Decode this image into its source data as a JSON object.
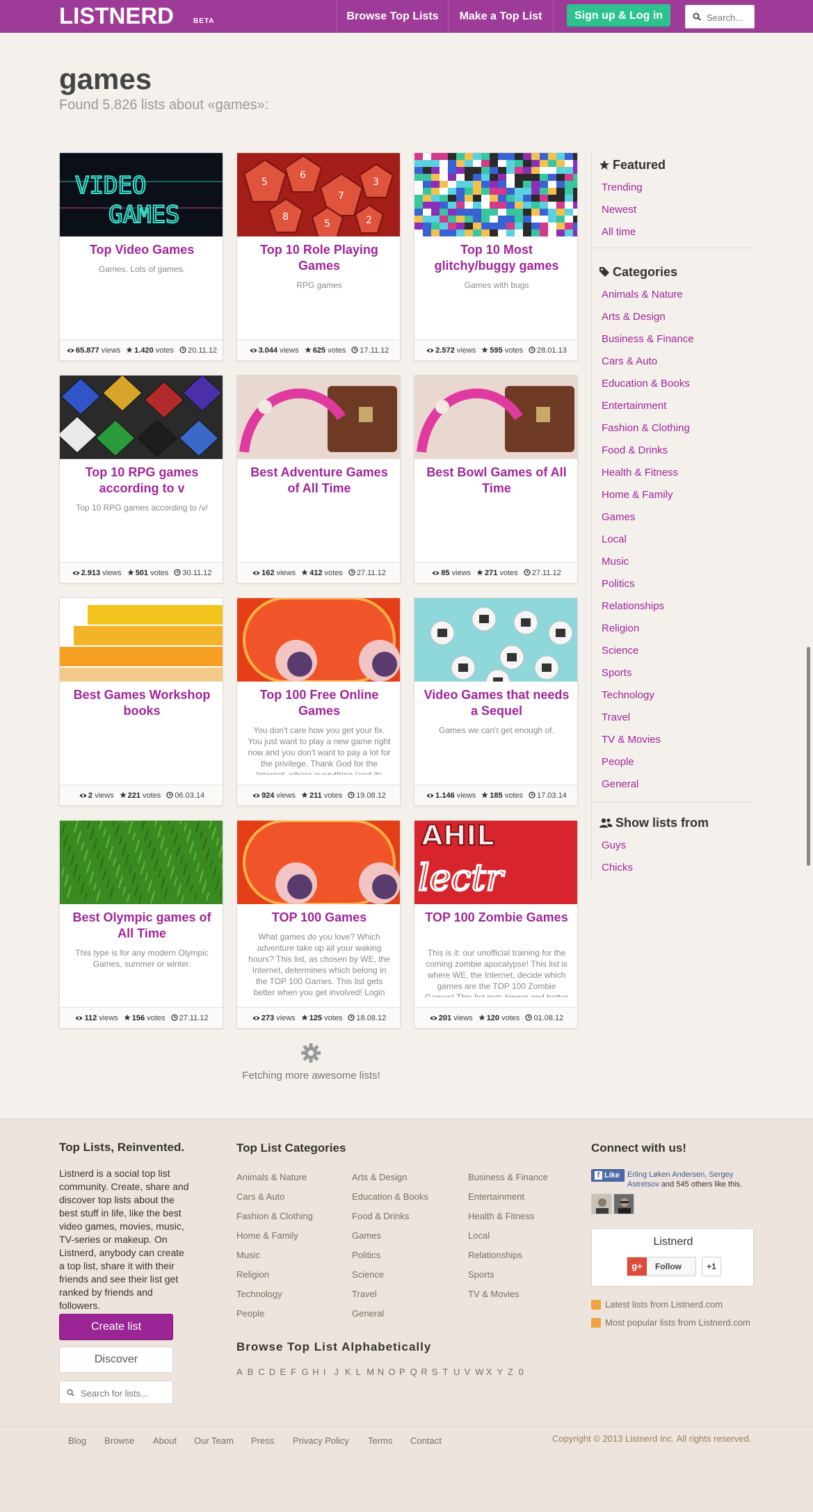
{
  "header": {
    "logo": "LISTNERD",
    "logo_badge": "BETA",
    "nav_browse": "Browse Top Lists",
    "nav_make": "Make a Top List",
    "signup": "Sign up & Log in",
    "search_placeholder": "Search..."
  },
  "page": {
    "title": "games",
    "subtitle": "Found 5.826 lists about «games»:"
  },
  "cards": [
    {
      "title": "Top Video Games",
      "desc": "Games. Lots of games.",
      "views": "65.877",
      "votes": "1.420",
      "date": "20.11.12",
      "image": "video-games"
    },
    {
      "title": "Top 10 Role Playing Games",
      "desc": "RPG games",
      "views": "3.044",
      "votes": "625",
      "date": "17.11.12",
      "image": "red-dice"
    },
    {
      "title": "Top 10 Most glitchy/buggy games",
      "desc": "Games with bugs",
      "views": "2.572",
      "votes": "595",
      "date": "28.01.13",
      "image": "glitch"
    },
    {
      "title": "Top 10 RPG games according to v",
      "desc": "Top 10 RPG games according to /v/",
      "views": "2.913",
      "votes": "501",
      "date": "30.11.12",
      "image": "color-dice"
    },
    {
      "title": "Best Adventure Games of All Time",
      "desc": "",
      "views": "162",
      "votes": "412",
      "date": "27.11.12",
      "image": "handbag"
    },
    {
      "title": "Best Bowl Games of All Time",
      "desc": "",
      "views": "85",
      "votes": "271",
      "date": "27.11.12",
      "image": "handbag"
    },
    {
      "title": "Best Games Workshop books",
      "desc": "",
      "views": "2",
      "votes": "221",
      "date": "06.03.14",
      "image": "books"
    },
    {
      "title": "Top 100 Free Online Games",
      "desc": "You don't care how you get your fix. You just want to play a new game right now and you don't want to pay a lot for the privilege. Thank God for the Internet, where everything (and its mom) is",
      "views": "924",
      "votes": "211",
      "date": "19.08.12",
      "image": "ghost"
    },
    {
      "title": "Video Games that needs a Sequel",
      "desc": "Games we can't get enough of.",
      "views": "1.146",
      "votes": "185",
      "date": "17.03.14",
      "image": "buttons"
    },
    {
      "title": "Best Olympic games of All Time",
      "desc": "This type is for any modern Olympic Games, summer or winter.",
      "views": "112",
      "votes": "156",
      "date": "27.11.12",
      "image": "grass"
    },
    {
      "title": "TOP 100 Games",
      "desc": "What games do you love? Which adventure take up all your waking hours? This list, as chosen by WE, the Internet, determines which belong in the TOP 100 Games. This list gets better when you get involved! Login Now to cast your vote or write in your own!",
      "views": "273",
      "votes": "125",
      "date": "18.08.12",
      "image": "ghost"
    },
    {
      "title": "TOP 100 Zombie Games",
      "desc": "This is it: our unofficial training for the coming zombie apocalypse! This list is where WE, the Internet, decide which games are the TOP 100 Zombie Games! This list gets bigger and better when you join in! Login now to cast your vote or write in your own!!",
      "views": "201",
      "votes": "120",
      "date": "01.08.12",
      "image": "neon"
    }
  ],
  "stats_labels": {
    "views": "views",
    "votes": "votes"
  },
  "sidebar": {
    "featured_title": "Featured",
    "featured": [
      "Trending",
      "Newest",
      "All time"
    ],
    "categories_title": "Categories",
    "categories": [
      "Animals & Nature",
      "Arts & Design",
      "Business & Finance",
      "Cars & Auto",
      "Education & Books",
      "Entertainment",
      "Fashion & Clothing",
      "Food & Drinks",
      "Health & Fitness",
      "Home & Family",
      "Games",
      "Local",
      "Music",
      "Politics",
      "Relationships",
      "Religion",
      "Science",
      "Sports",
      "Technology",
      "Travel",
      "TV & Movies",
      "People",
      "General"
    ],
    "show_title": "Show lists from",
    "show": [
      "Guys",
      "Chicks"
    ]
  },
  "loader": {
    "text": "Fetching more awesome lists!"
  },
  "footer": {
    "about_title": "Top Lists, Reinvented.",
    "about_text": "Listnerd is a social top list community. Create, share and discover top lists about the best stuff in life, like the best video games, movies, music, TV-series or makeup. On Listnerd, anybody can create a top list, share it with their friends and see their list get ranked by friends and followers.",
    "create_btn": "Create list",
    "discover_btn": "Discover",
    "search_placeholder": "Search for lists...",
    "categories_title": "Top List Categories",
    "categories": [
      "Animals & Nature",
      "Arts & Design",
      "Business & Finance",
      "Cars & Auto",
      "Education & Books",
      "Entertainment",
      "Fashion & Clothing",
      "Food & Drinks",
      "Health & Fitness",
      "Home & Family",
      "Games",
      "Local",
      "Music",
      "Politics",
      "Relationships",
      "Religion",
      "Science",
      "Sports",
      "Technology",
      "Travel",
      "TV & Movies",
      "People",
      "General"
    ],
    "alpha_title": "Browse Top List Alphabetically",
    "alphabet": [
      "A",
      "B",
      "C",
      "D",
      "E",
      "F",
      "G",
      "H",
      "I",
      "J",
      "K",
      "L",
      "M",
      "N",
      "O",
      "P",
      "Q",
      "R",
      "S",
      "T",
      "U",
      "V",
      "W",
      "X",
      "Y",
      "Z",
      "0"
    ],
    "connect_title": "Connect with us!",
    "fb_like": "Like",
    "fb_names": "Erling Løken Andersen, Sergey Astretsov",
    "fb_rest": " and 545 others like this.",
    "gplus_name": "Listnerd",
    "gplus_follow": "Follow",
    "gplus_count": "+1",
    "rss_latest": "Latest lists from Listnerd.com",
    "rss_popular": "Most popular lists from Listnerd.com",
    "links": [
      "Blog",
      "Browse",
      "About",
      "Our Team",
      "Press",
      "Privacy Policy",
      "Terms",
      "Contact"
    ],
    "copyright": "Copyright © 2013 Listnerd Inc. All rights reserved."
  },
  "colors": {
    "brand": "#9e3b98",
    "link": "#a1259a",
    "signup": "#2ec38e",
    "background": "#f4f1ec"
  }
}
